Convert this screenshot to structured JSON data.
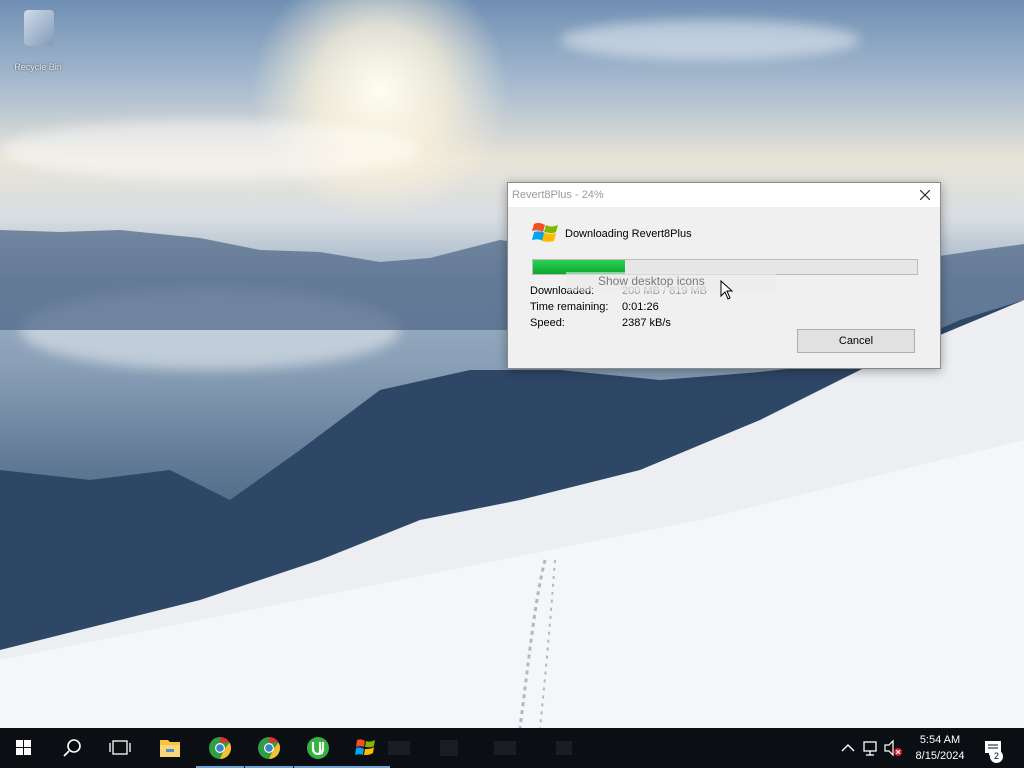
{
  "desktop": {
    "icon_label": "Recycle Bin"
  },
  "dialog": {
    "title": "Revert8Plus - 24%",
    "heading": "Downloading Revert8Plus",
    "progress_percent": 24,
    "labels": {
      "downloaded": "Downloaded:",
      "time_remaining": "Time remaining:",
      "speed": "Speed:"
    },
    "values": {
      "downloaded": "200 MB / 819 MB",
      "time_remaining": "0:01:26",
      "speed": "2387 kB/s"
    },
    "cancel_label": "Cancel"
  },
  "tooltip": {
    "text": "Show desktop icons"
  },
  "taskbar": {
    "pinned": [
      "start-icon",
      "search-icon",
      "task-view-icon",
      "file-explorer-icon",
      "chrome-icon",
      "chrome-icon",
      "utorrent-icon",
      "windows-flag-icon"
    ],
    "clock": {
      "time": "5:54 AM",
      "date": "8/15/2024"
    },
    "notification_count": "2"
  },
  "colors": {
    "progress_green": "#09a82f",
    "taskbar_bg": "#0b0e12",
    "utorrent_green": "#36b241"
  }
}
